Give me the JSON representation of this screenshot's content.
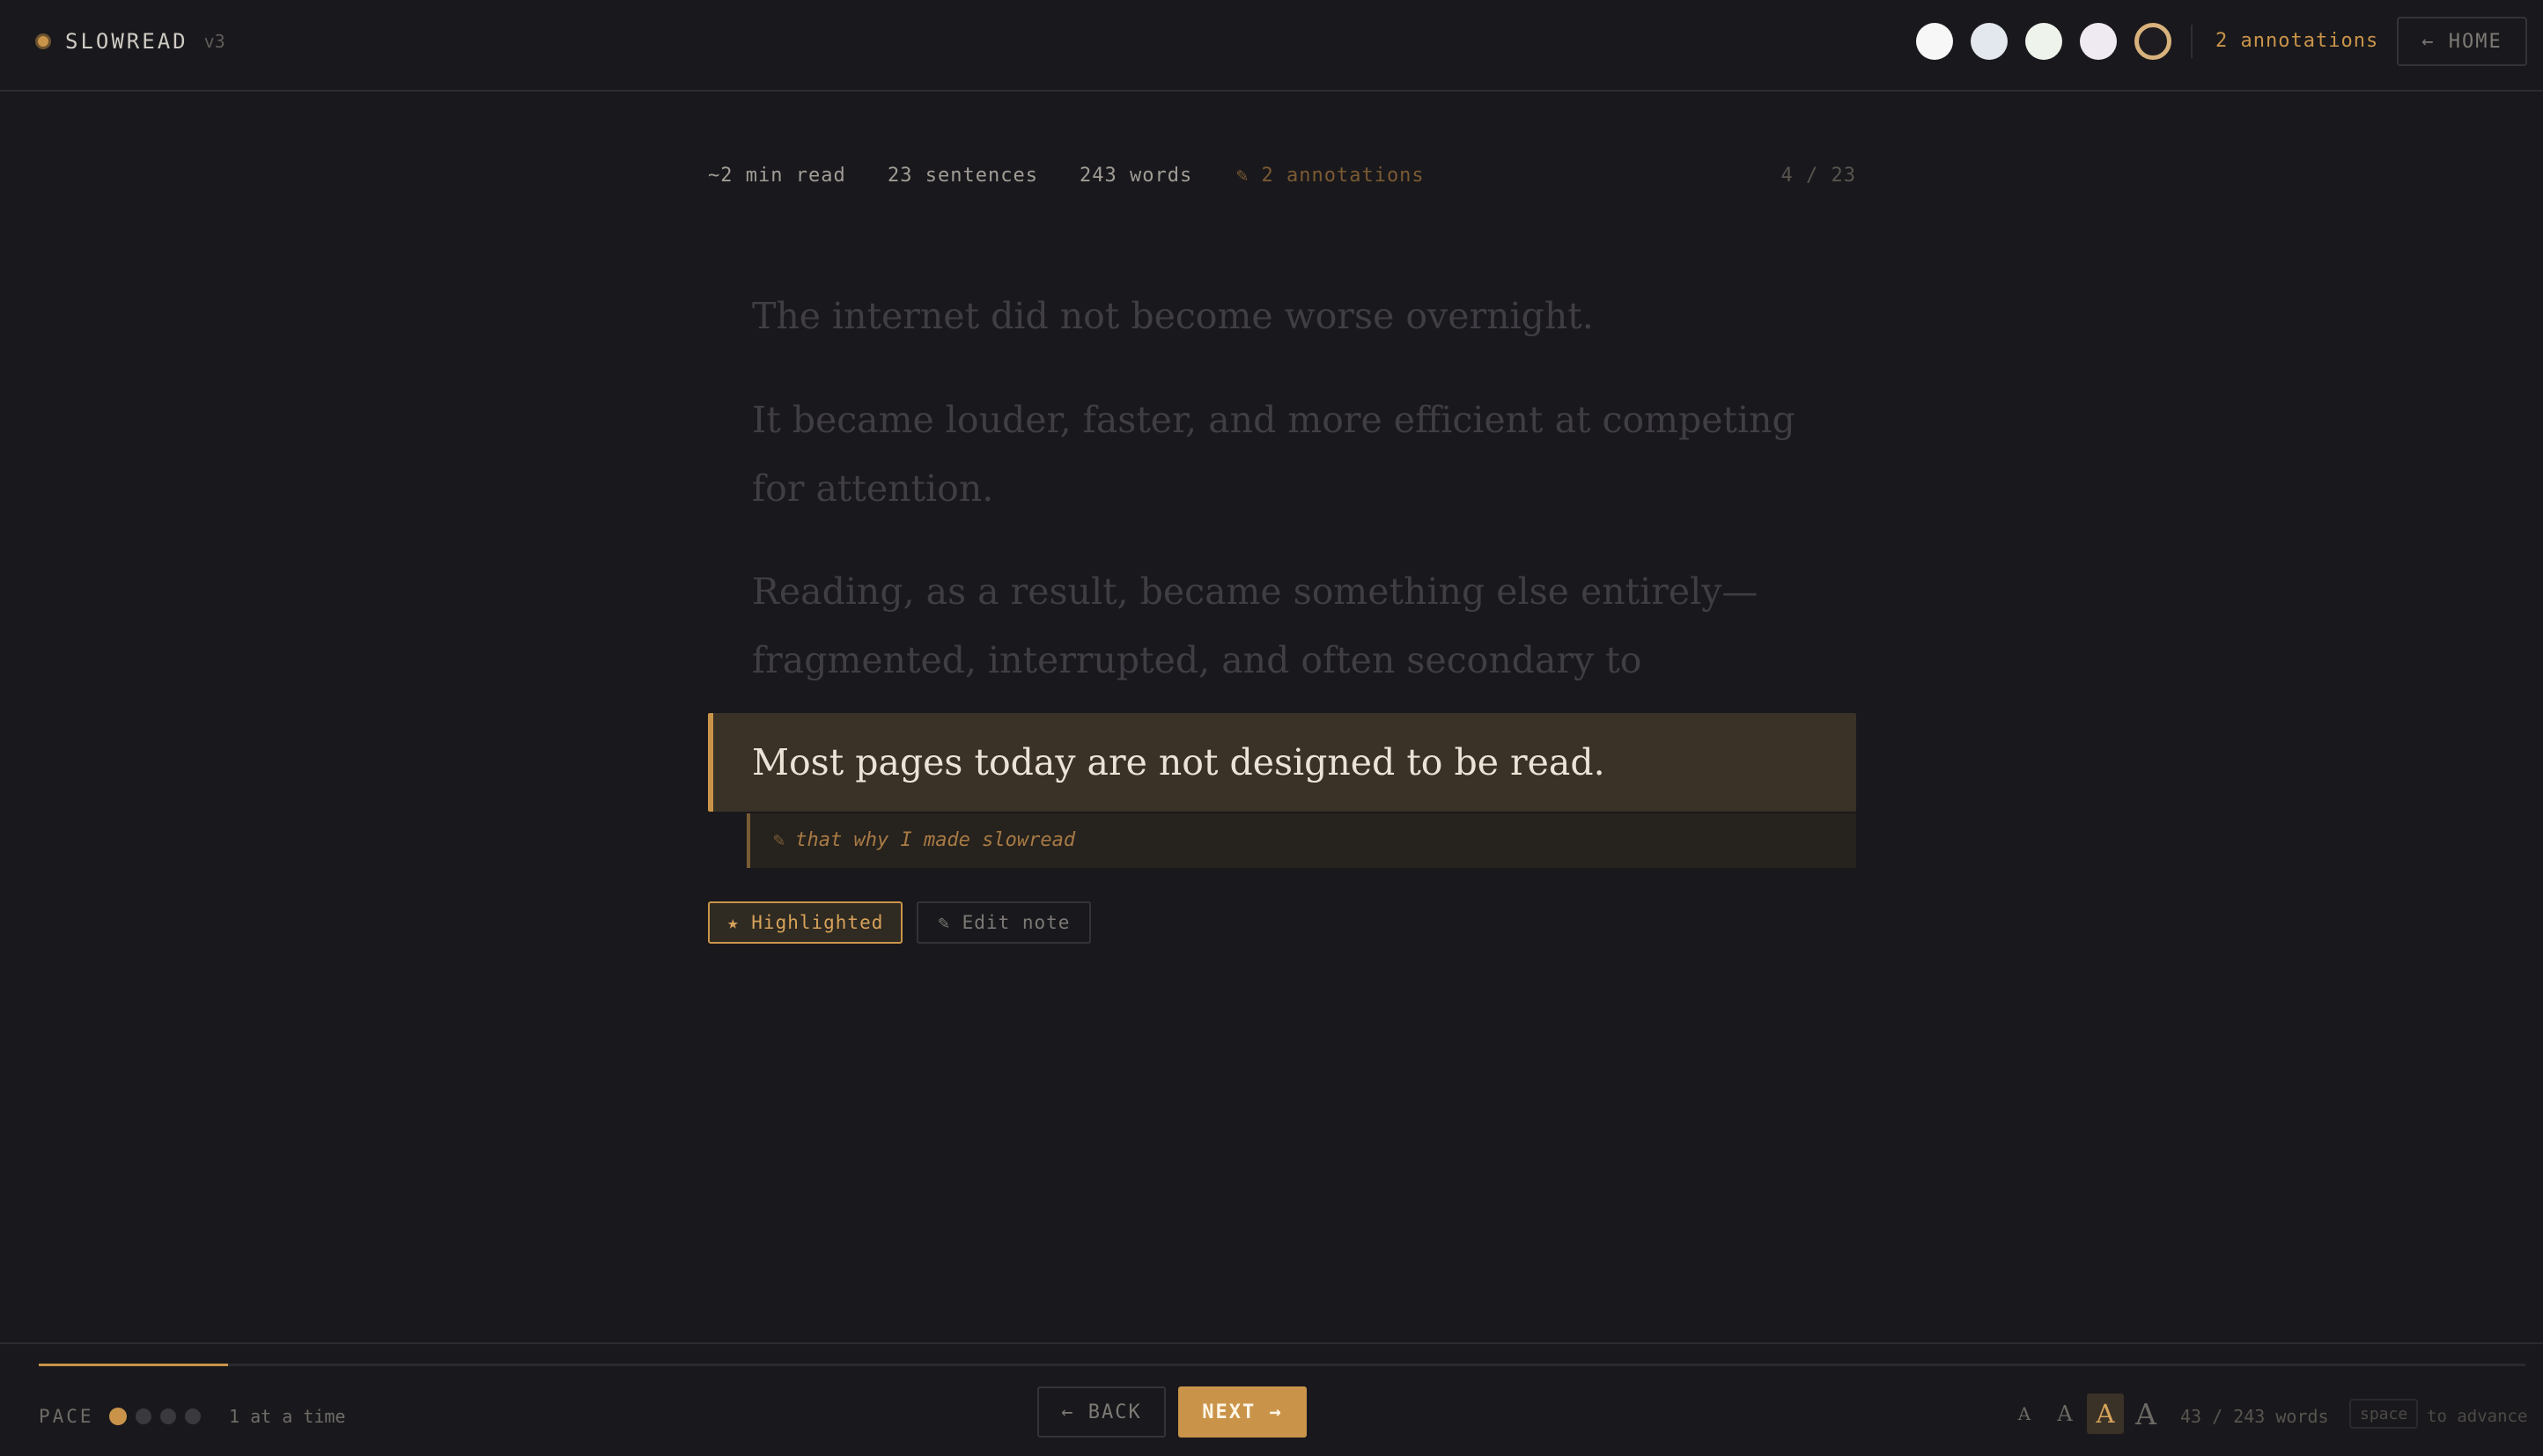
{
  "app": {
    "name": "SLOWREAD",
    "version": "v3"
  },
  "header": {
    "theme_swatches": [
      {
        "name": "white",
        "color": "#f7f7f7"
      },
      {
        "name": "cool-white",
        "color": "#e3e7ee"
      },
      {
        "name": "mint-white",
        "color": "#eef3ec"
      },
      {
        "name": "lavender-white",
        "color": "#efe9f2"
      },
      {
        "name": "dark",
        "color": "#1e1c20",
        "active": true
      }
    ],
    "annotations_label": "2 annotations",
    "home_label": "← HOME"
  },
  "stats": {
    "read_time": "~2 min read",
    "sentences": "23 sentences",
    "words": "243 words",
    "annotations": "✎ 2 annotations",
    "position": "4 / 23"
  },
  "reading": {
    "previous_sentences": [
      "The internet did not become worse overnight.",
      "It became louder, faster, and more efficient at competing for attention.",
      "Reading, as a result, became something else entirely—fragmented, interrupted, and often secondary to everything surrounding it."
    ],
    "current_sentence": "Most pages today are not designed to be read.",
    "note_icon": "✎",
    "note_text": "that why I made slowread"
  },
  "actions": {
    "highlighted_label": "★ Highlighted",
    "edit_note_label": "✎ Edit note"
  },
  "footer": {
    "progress_fraction": 0.0762,
    "pace_label": "PACE",
    "pace_level": 1,
    "pace_levels_total": 4,
    "pace_text": "1 at a time",
    "back_label": "← BACK",
    "next_label": "NEXT →",
    "font_sizes": [
      "A",
      "A",
      "A",
      "A"
    ],
    "active_font_size": 3,
    "word_count": "43 / 243 words",
    "key_label": "space",
    "key_hint": "to advance"
  },
  "colors": {
    "accent": "#c9944a",
    "background": "#19181c",
    "current_sentence_bg": "#3a3127"
  }
}
